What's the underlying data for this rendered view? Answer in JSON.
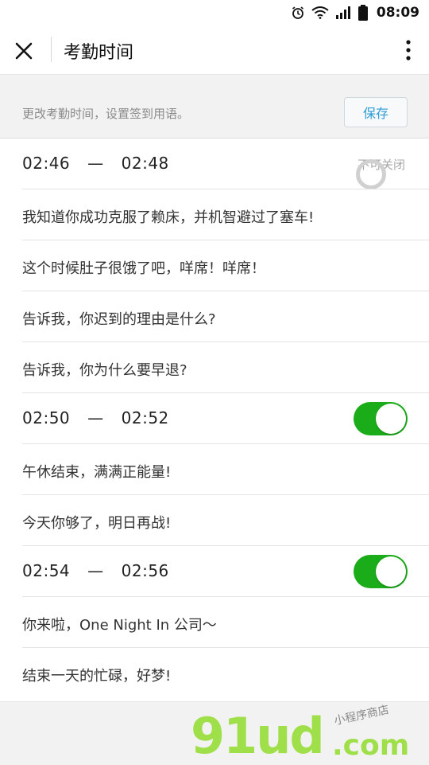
{
  "status_bar": {
    "time": "08:09"
  },
  "nav": {
    "title": "考勤时间"
  },
  "settings": {
    "hint": "更改考勤时间，设置签到用语。",
    "save_label": "保存"
  },
  "groups": [
    {
      "start": "02:46",
      "end": "02:48",
      "dash": "—",
      "status_label": "不可关闭",
      "phrases": [
        "我知道你成功克服了赖床，并机智避过了塞车!",
        "这个时候肚子很饿了吧，咩席！咩席！",
        "告诉我，你迟到的理由是什么?",
        "告诉我，你为什么要早退?"
      ]
    },
    {
      "start": "02:50",
      "end": "02:52",
      "dash": "—",
      "toggle_on": true,
      "phrases": [
        "午休结束，满满正能量!",
        "今天你够了，明日再战!"
      ]
    },
    {
      "start": "02:54",
      "end": "02:56",
      "dash": "—",
      "toggle_on": true,
      "phrases": [
        "你来啦，One Night In 公司～",
        "结束一天的忙碌，好梦!"
      ]
    }
  ],
  "watermark": {
    "main": "91ud",
    "suffix": ".com",
    "sub": "小程序商店"
  },
  "colors": {
    "toggle_on": "#1aad19",
    "save_text": "#2f9bd6",
    "watermark": "#9fe04a"
  }
}
